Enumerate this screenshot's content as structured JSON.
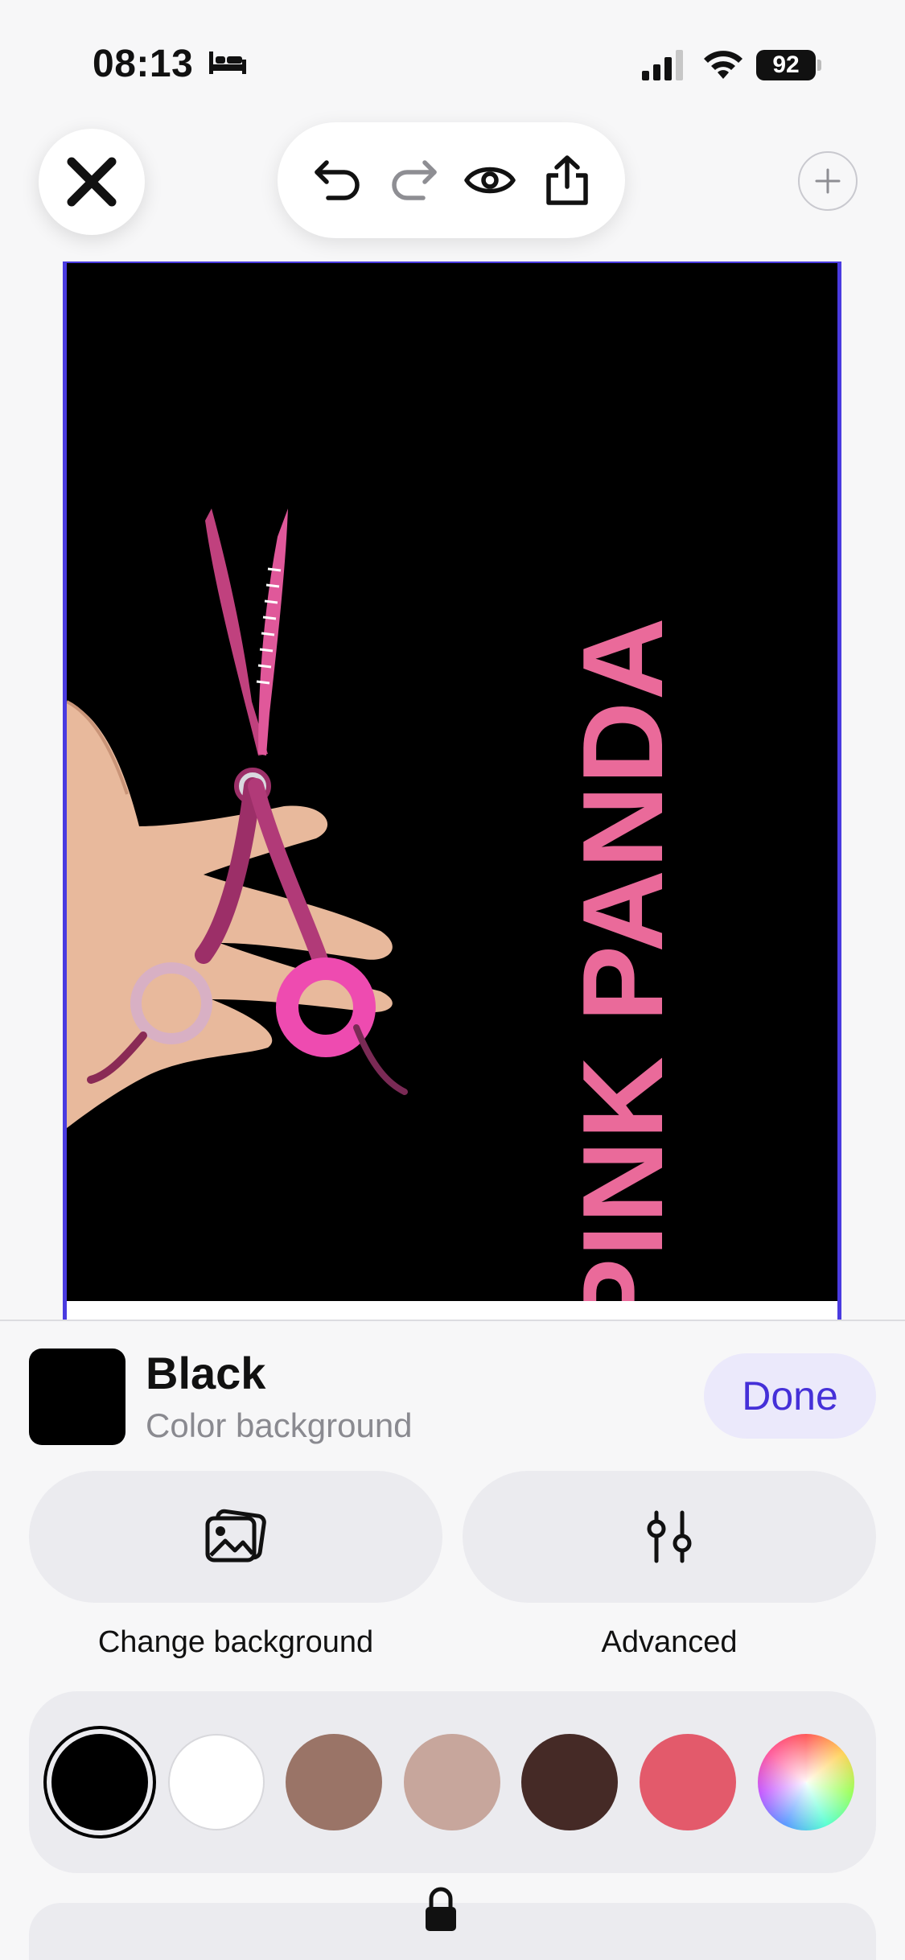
{
  "status_bar": {
    "time": "08:13",
    "battery": "92",
    "icons": [
      "bed-icon",
      "signal-icon",
      "wifi-icon",
      "battery-icon"
    ]
  },
  "toolbar": {
    "close": "close-icon",
    "tools": [
      "undo-icon",
      "redo-icon",
      "preview-eye-icon",
      "share-icon"
    ],
    "add": "plus-icon"
  },
  "canvas": {
    "background_color": "#000000",
    "brand_text": "PINK PANDA",
    "brand_color": "#ea6a9a",
    "selection_color": "#4a3be0"
  },
  "sheet": {
    "title": "Black",
    "subtitle": "Color background",
    "done_label": "Done",
    "change_background_label": "Change background",
    "advanced_label": "Advanced",
    "icons": [
      "photos-icon",
      "sliders-icon",
      "lock-icon"
    ]
  },
  "palette": {
    "colors": [
      "#000000",
      "#ffffff",
      "#9a7467",
      "#c7a69c",
      "#452a26",
      "#e35a6b",
      "rainbow"
    ],
    "selected": "#000000"
  }
}
